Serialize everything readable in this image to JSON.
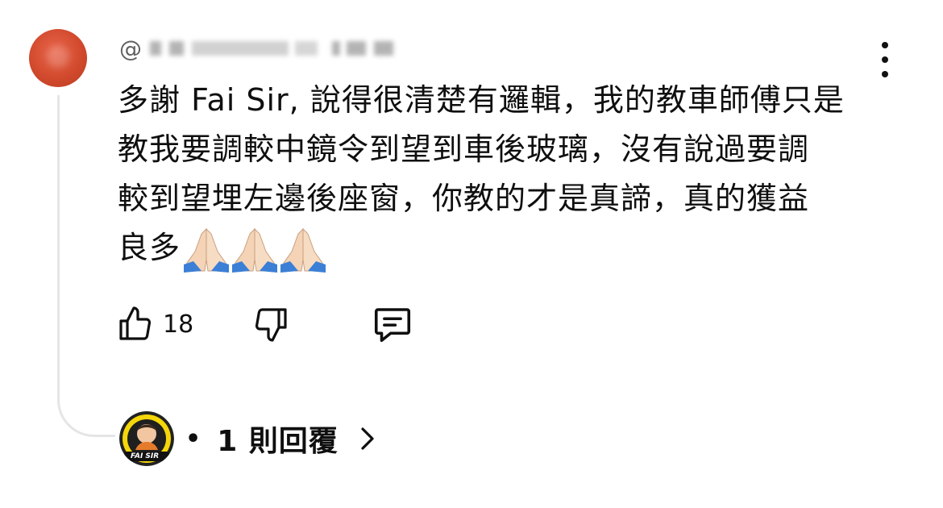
{
  "comment": {
    "username_prefix": "@",
    "text": "多謝 Fai Sir, 說得很清楚有邏輯，我的教車師傅只是\n教我要調較中鏡令到望到車後玻璃，沒有說過要調\n較到望埋左邊後座窗，你教的才是真諦，真的獲益\n良多",
    "emoji": "🙏🙏🙏",
    "like_count": "18"
  },
  "replies": {
    "label": "1 則回覆",
    "separator": "•",
    "creator_badge_text": "FAI SIR"
  },
  "icons": {
    "like": "thumbs-up-icon",
    "dislike": "thumbs-down-icon",
    "reply": "comment-icon",
    "more": "more-vertical-icon",
    "expand": "chevron-right-icon"
  },
  "colors": {
    "avatar": "#d24a2d",
    "text": "#0f0f0f",
    "thread_line": "#e5e5e5",
    "creator_ring": "#f5d60a"
  }
}
